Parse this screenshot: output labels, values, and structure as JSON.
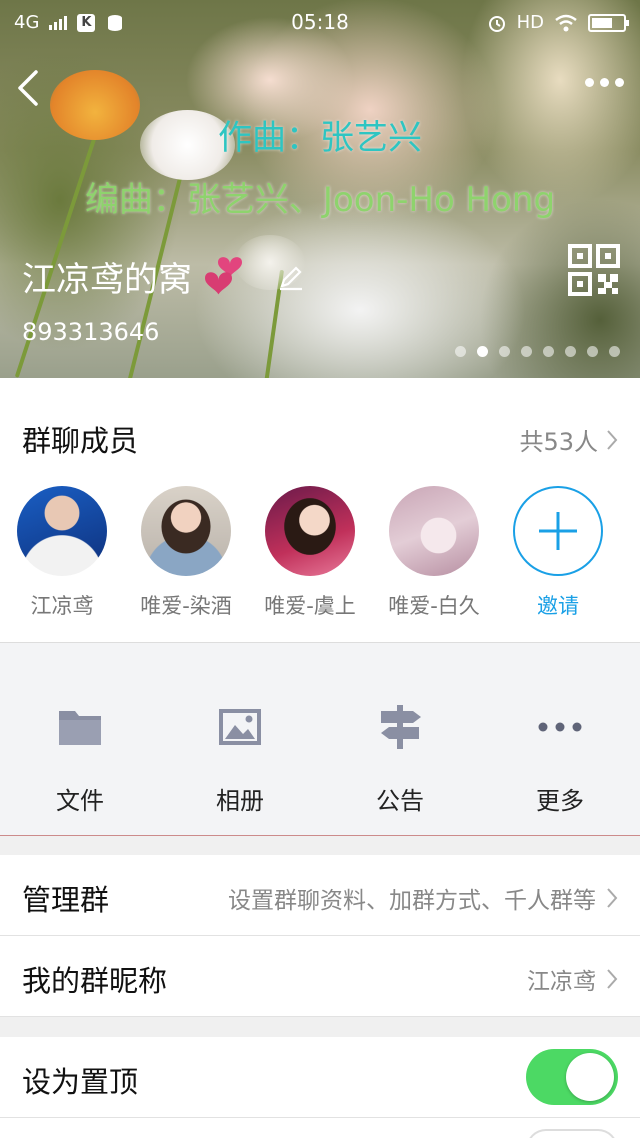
{
  "status_bar": {
    "network": "4G",
    "app_badge": "K",
    "time": "05:18",
    "hd": "HD"
  },
  "header": {
    "lyric_line1": "作曲：张艺兴",
    "lyric_line2": "编曲：张艺兴、Joon-Ho Hong",
    "group_name": "江凉鸢的窝",
    "group_id": "893313646",
    "carousel": {
      "total": 8,
      "active_index": 1
    }
  },
  "members": {
    "title": "群聊成员",
    "count_label": "共53人",
    "list": [
      {
        "name": "江凉鸢",
        "avatar": "avatar-1"
      },
      {
        "name": "唯爱-染酒",
        "avatar": "avatar-2"
      },
      {
        "name": "唯爱-虞上",
        "avatar": "avatar-3"
      },
      {
        "name": "唯爱-白久",
        "avatar": "avatar-4"
      }
    ],
    "invite_label": "邀请"
  },
  "actions": [
    {
      "label": "文件",
      "icon": "folder-icon"
    },
    {
      "label": "相册",
      "icon": "image-icon"
    },
    {
      "label": "公告",
      "icon": "signpost-icon"
    },
    {
      "label": "更多",
      "icon": "more-icon"
    }
  ],
  "settings": {
    "manage": {
      "title": "管理群",
      "value": "设置群聊资料、加群方式、千人群等"
    },
    "nickname": {
      "title": "我的群昵称",
      "value": "江凉鸢"
    },
    "pin": {
      "title": "设为置顶",
      "enabled": true
    }
  },
  "colors": {
    "accent": "#1aa0e6",
    "toggle_on": "#4cd964",
    "lyric1": "#2ec5c2",
    "lyric2": "#8ed36d"
  }
}
